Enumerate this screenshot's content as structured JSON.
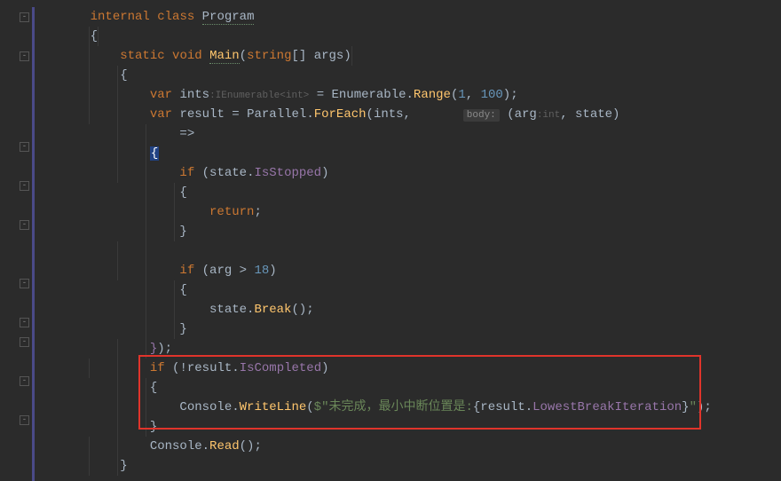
{
  "code": {
    "l1": {
      "indent1": "    ",
      "kw1": "internal",
      "sp": " ",
      "kw2": "class",
      "sp2": " ",
      "cls": "Program"
    },
    "l2": {
      "indent": "    ",
      "brace": "{"
    },
    "l3": {
      "indent": "        ",
      "kw1": "static",
      "sp": " ",
      "kw2": "void",
      "sp2": " ",
      "mth": "Main",
      "p1": "(",
      "type": "string",
      "arr": "[]",
      "sp3": " ",
      "arg": "args",
      "p2": ")"
    },
    "l4": {
      "indent": "        ",
      "brace": "{"
    },
    "l5": {
      "indent": "            ",
      "kw": "var",
      "sp": " ",
      "name": "ints",
      "hint": ":IEnumerable<int>",
      "sp2": " ",
      "eq": "=",
      "sp3": " ",
      "cls": "Enumerable",
      "dot": ".",
      "mth": "Range",
      "open": "(",
      "n1": "1",
      "c": ", ",
      "n2": "100",
      "close": ")",
      "semi": ";"
    },
    "l6": {
      "indent": "            ",
      "kw": "var",
      "sp": " ",
      "name": "result",
      "sp2": " ",
      "eq": "=",
      "sp3": " ",
      "cls": "Parallel",
      "dot": ".",
      "mth": "ForEach",
      "open": "(",
      "a1": "ints",
      "c1": ",",
      "sp4": "       ",
      "hint": "body:",
      "sp5": " ",
      "op": "(",
      "arg1": "arg",
      "h2": ":int",
      "c2": ", ",
      "arg2": "state",
      "cp": ")"
    },
    "l7": {
      "indent": "                ",
      "arrow": "=>"
    },
    "l8": {
      "indent": "            ",
      "brace": "{"
    },
    "l9": {
      "indent": "                ",
      "kw": "if",
      "sp": " ",
      "op": "(",
      "v": "state",
      "dot": ".",
      "prop": "IsStopped",
      "cp": ")"
    },
    "l10": {
      "indent": "                ",
      "brace": "{"
    },
    "l11": {
      "indent": "                    ",
      "kw": "return",
      "semi": ";"
    },
    "l12": {
      "indent": "                ",
      "brace": "}"
    },
    "l13": {
      "indent": ""
    },
    "l14": {
      "indent": "                ",
      "kw": "if",
      "sp": " ",
      "op": "(",
      "v": "arg",
      "sp2": " ",
      "gt": ">",
      "sp3": " ",
      "n": "18",
      "cp": ")"
    },
    "l15": {
      "indent": "                ",
      "brace": "{"
    },
    "l16": {
      "indent": "                    ",
      "v": "state",
      "dot": ".",
      "mth": "Break",
      "p": "()",
      "semi": ";"
    },
    "l17": {
      "indent": "                ",
      "brace": "}"
    },
    "l18": {
      "indent": "            ",
      "brace": "}",
      "close": ")",
      "semi": ";"
    },
    "l19": {
      "indent": "            ",
      "kw": "if",
      "sp": " ",
      "op": "(",
      "neg": "!",
      "v": "result",
      "dot": ".",
      "prop": "IsCompleted",
      "cp": ")"
    },
    "l20": {
      "indent": "            ",
      "brace": "{"
    },
    "l21": {
      "indent": "                ",
      "cls": "Console",
      "dot": ".",
      "mth": "WriteLine",
      "op": "(",
      "d": "$",
      "q1": "\"",
      "s1": "未完成，最小中断位置是:",
      "ib": "{",
      "v": "result",
      "d2": ".",
      "prop": "LowestBreakIteration",
      "ie": "}",
      "q2": "\"",
      "cp": ")",
      "semi": ";"
    },
    "l22": {
      "indent": "            ",
      "brace": "}"
    },
    "l23": {
      "indent": "            ",
      "cls": "Console",
      "dot": ".",
      "mth": "Read",
      "p": "()",
      "semi": ";"
    },
    "l24": {
      "indent": "        ",
      "brace": "}"
    }
  },
  "folds": [
    "-",
    "-",
    "-",
    "-",
    "-",
    "-",
    "-",
    "-",
    "-",
    "-"
  ],
  "colors": {
    "highlight_box": "#e0342b"
  }
}
